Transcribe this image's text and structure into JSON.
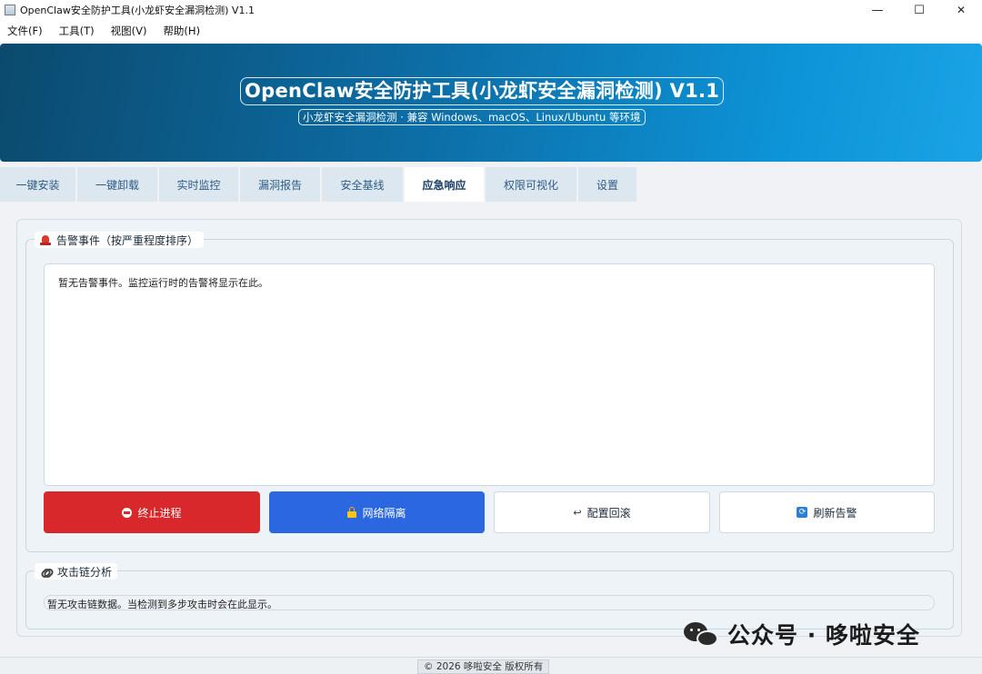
{
  "window": {
    "title": "OpenClaw安全防护工具(小龙虾安全漏洞检测) V1.1",
    "controls": {
      "minimize": "—",
      "maximize": "☐",
      "close": "✕"
    }
  },
  "menu": [
    "文件(F)",
    "工具(T)",
    "视图(V)",
    "帮助(H)"
  ],
  "banner": {
    "title": "OpenClaw安全防护工具(小龙虾安全漏洞检测) V1.1",
    "subtitle": "小龙虾安全漏洞检测 · 兼容 Windows、macOS、Linux/Ubuntu 等环境",
    "gradient_colors": [
      "#0b4a6e",
      "#0d94d8"
    ]
  },
  "tabs": [
    {
      "label": "一键安装"
    },
    {
      "label": "一键卸载"
    },
    {
      "label": "实时监控"
    },
    {
      "label": "漏洞报告"
    },
    {
      "label": "安全基线"
    },
    {
      "label": "应急响应",
      "active": true
    },
    {
      "label": "权限可视化"
    },
    {
      "label": "设置"
    }
  ],
  "alerts": {
    "group_title": "告警事件（按严重程度排序）",
    "icon": "alarm-bell-icon",
    "empty_message": "暂无告警事件。监控运行时的告警将显示在此。"
  },
  "actions": {
    "kill": {
      "label": "终止进程",
      "icon": "stop-icon",
      "color": "#d8282b"
    },
    "isolate": {
      "label": "网络隔离",
      "icon": "lock-icon",
      "color": "#2b67e0"
    },
    "rollback": {
      "label": "配置回滚",
      "icon": "undo-icon",
      "glyph": "↩"
    },
    "refresh": {
      "label": "刷新告警",
      "icon": "refresh-icon",
      "glyph": "⟳"
    }
  },
  "attack_chain": {
    "group_title": "攻击链分析",
    "icon": "chain-link-icon",
    "empty_message": "暂无攻击链数据。当检测到多步攻击时会在此显示。"
  },
  "status": {
    "text": "© 2026 哆啦安全 版权所有"
  },
  "watermark": {
    "text": "公众号 · 哆啦安全",
    "icon": "wechat-icon"
  }
}
